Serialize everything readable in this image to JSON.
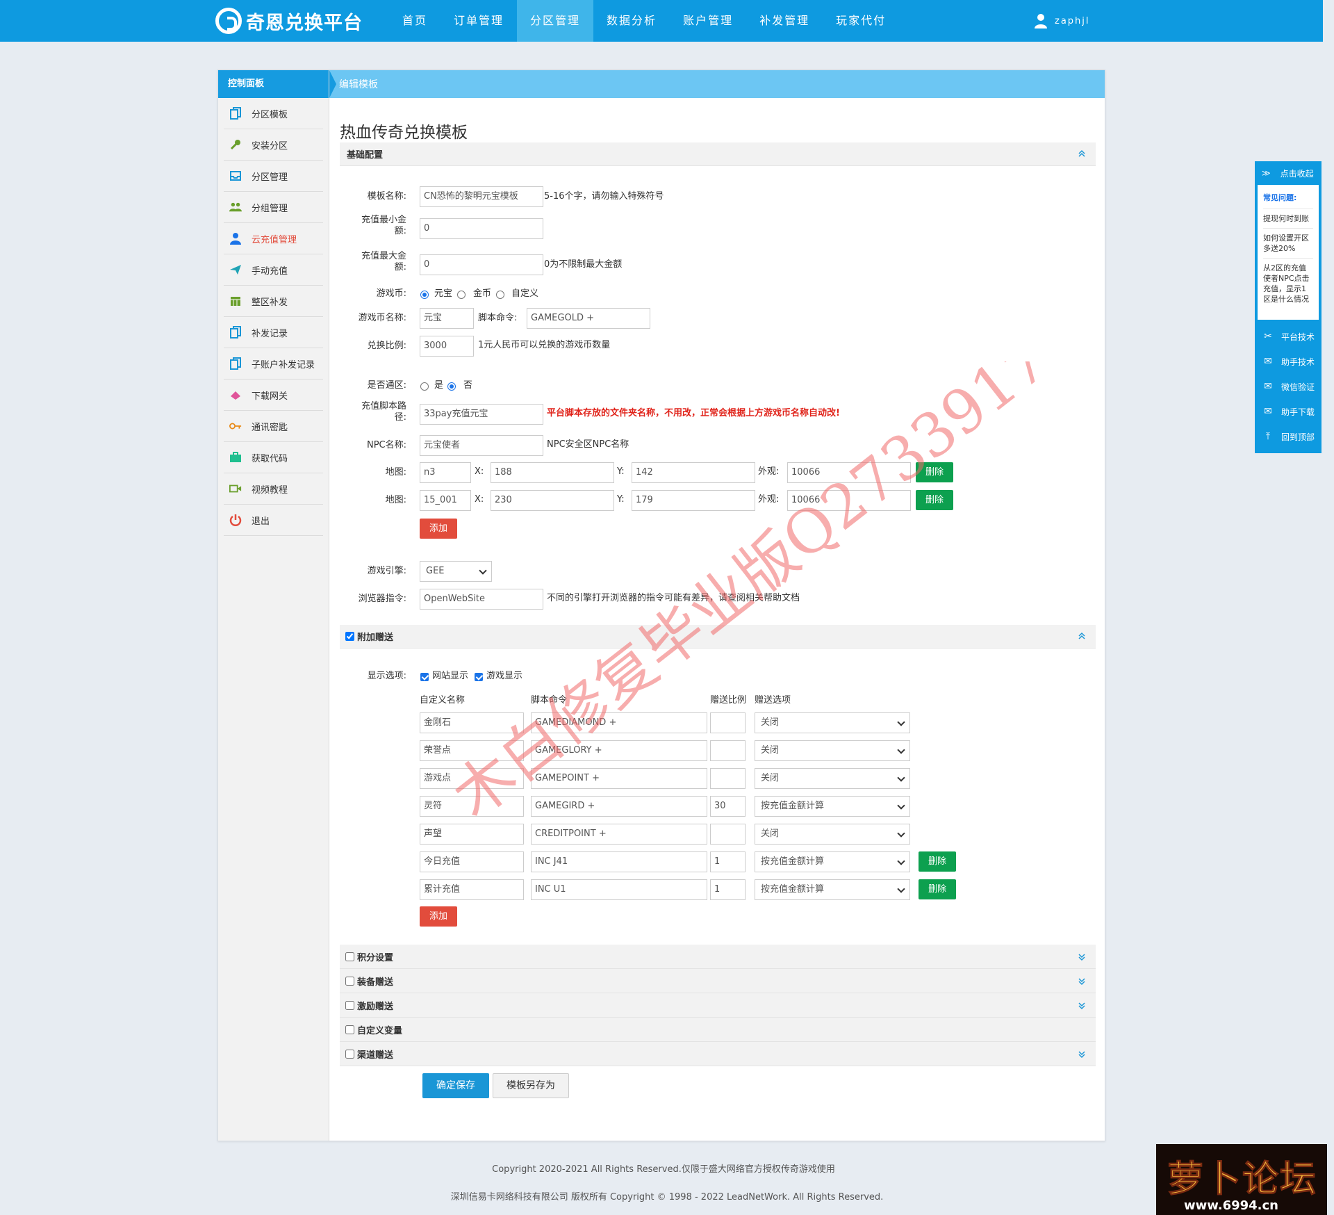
{
  "topnav": {
    "brand": "奇恩兑换平台",
    "items": [
      "首页",
      "订单管理",
      "分区管理",
      "数据分析",
      "账户管理",
      "补发管理",
      "玩家代付"
    ],
    "active_index": 2,
    "user": "zaphjl"
  },
  "sidebar": {
    "title": "控制面板",
    "items": [
      {
        "label": "分区模板",
        "icon": "copy-icon",
        "color": "#1a96d6"
      },
      {
        "label": "安装分区",
        "icon": "wrench-icon",
        "color": "#6a9f2c"
      },
      {
        "label": "分区管理",
        "icon": "inbox-icon",
        "color": "#1a96d6"
      },
      {
        "label": "分组管理",
        "icon": "group-icon",
        "color": "#6a9f2c"
      },
      {
        "label": "云充值管理",
        "icon": "user-icon",
        "color": "#1a73e8",
        "active": true
      },
      {
        "label": "手动充值",
        "icon": "paper-plane-icon",
        "color": "#1fa3b5"
      },
      {
        "label": "整区补发",
        "icon": "calendar-icon",
        "color": "#6a9f2c"
      },
      {
        "label": "补发记录",
        "icon": "copy-icon",
        "color": "#1a96d6"
      },
      {
        "label": "子账户补发记录",
        "icon": "copy-icon",
        "color": "#1a96d6"
      },
      {
        "label": "下载网关",
        "icon": "eraser-icon",
        "color": "#e0549a"
      },
      {
        "label": "通讯密匙",
        "icon": "key-icon",
        "color": "#e88b1a"
      },
      {
        "label": "获取代码",
        "icon": "briefcase-icon",
        "color": "#1fbf8f"
      },
      {
        "label": "视频教程",
        "icon": "video-icon",
        "color": "#6a9f2c"
      },
      {
        "label": "退出",
        "icon": "power-icon",
        "color": "#e24c3c"
      }
    ]
  },
  "panel": {
    "title": "编辑模板"
  },
  "page": {
    "title": "热血传奇兑换模板"
  },
  "basic": {
    "section_title": "基础配置",
    "template_name": {
      "label": "模板名称:",
      "value": "CN恐怖的黎明元宝模板",
      "hint": "5-16个字，请勿输入特殊符号"
    },
    "min_amount": {
      "label_1": "充值最小金",
      "label_2": "额:",
      "value": "0"
    },
    "max_amount": {
      "label_1": "充值最大金",
      "label_2": "额:",
      "value": "0",
      "hint": "0为不限制最大金额"
    },
    "currency": {
      "label": "游戏币:",
      "options": [
        "元宝",
        "金币",
        "自定义"
      ],
      "selected": 0
    },
    "currency_name": {
      "label": "游戏币名称:",
      "value": "元宝",
      "script_label": "脚本命令:",
      "script_value": "GAMEGOLD +"
    },
    "ratio": {
      "label": "兑换比例:",
      "value": "3000",
      "hint": "1元人民币可以兑换的游戏币数量"
    },
    "universal": {
      "label": "是否通区:",
      "options": [
        "是",
        "否"
      ],
      "selected": 1
    },
    "script_path": {
      "label_1": "充值脚本路",
      "label_2": "径:",
      "value": "33pay充值元宝",
      "hint": "平台脚本存放的文件夹名称，不用改，正常会根据上方游戏币名称自动改!"
    },
    "npc": {
      "label": "NPC名称:",
      "value": "元宝使者",
      "hint": "NPC安全区NPC名称"
    },
    "maps": [
      {
        "label": "地图:",
        "map": "n3",
        "x_label": "X:",
        "x": "188",
        "y_label": "Y:",
        "y": "142",
        "look_label": "外观:",
        "look": "10066",
        "delete": "删除"
      },
      {
        "label": "地图:",
        "map": "15_001",
        "x_label": "X:",
        "x": "230",
        "y_label": "Y:",
        "y": "179",
        "look_label": "外观:",
        "look": "10066",
        "delete": "删除"
      }
    ],
    "add_label": "添加",
    "engine": {
      "label": "游戏引擎:",
      "value": "GEE"
    },
    "browser_cmd": {
      "label": "浏览器指令:",
      "value": "OpenWebSite",
      "hint": "不同的引擎打开浏览器的指令可能有差异，请查阅相关帮助文档"
    }
  },
  "bonus": {
    "section_title": "附加赠送",
    "display_label": "显示选项:",
    "display_options": [
      "网站显示",
      "游戏显示"
    ],
    "columns": [
      "自定义名称",
      "脚本命令",
      "赠送比例",
      "赠送选项"
    ],
    "rows": [
      {
        "name": "金刚石",
        "cmd": "GAMEDIAMOND +",
        "ratio": "",
        "option": "关闭"
      },
      {
        "name": "荣誉点",
        "cmd": "GAMEGLORY +",
        "ratio": "",
        "option": "关闭"
      },
      {
        "name": "游戏点",
        "cmd": "GAMEPOINT +",
        "ratio": "",
        "option": "关闭"
      },
      {
        "name": "灵符",
        "cmd": "GAMEGIRD +",
        "ratio": "30",
        "option": "按充值金额计算"
      },
      {
        "name": "声望",
        "cmd": "CREDITPOINT +",
        "ratio": "",
        "option": "关闭"
      },
      {
        "name": "今日充值",
        "cmd": "INC J41",
        "ratio": "1",
        "option": "按充值金额计算",
        "delete": "删除"
      },
      {
        "name": "累计充值",
        "cmd": "INC U1",
        "ratio": "1",
        "option": "按充值金额计算",
        "delete": "删除"
      }
    ],
    "add_label": "添加"
  },
  "collapsed_sections": [
    {
      "title": "积分设置",
      "chevron": true
    },
    {
      "title": "装备赠送",
      "chevron": true
    },
    {
      "title": "激励赠送",
      "chevron": true
    },
    {
      "title": "自定义变量",
      "chevron": false
    },
    {
      "title": "渠道赠送",
      "chevron": true
    }
  ],
  "actions": {
    "save": "确定保存",
    "save_as": "模板另存为"
  },
  "float_panel": {
    "collapse": "点击收起",
    "faq_title": "常见问题:",
    "faq": [
      "提现何时到账",
      "如何设置开区多送20%",
      "从2区的充值使者NPC点击充值，显示1区是什么情况"
    ],
    "links": [
      {
        "label": "平台技术",
        "icon": "tools-icon"
      },
      {
        "label": "助手技术",
        "icon": "chat-icon"
      },
      {
        "label": "微信验证",
        "icon": "chat-icon"
      },
      {
        "label": "助手下载",
        "icon": "chat-icon"
      },
      {
        "label": "回到顶部",
        "icon": "arrow-up-icon"
      }
    ]
  },
  "footer": {
    "line1": "Copyright 2020-2021 All Rights Reserved.仅限于盛大网络官方授权传奇游戏使用",
    "line2": "深圳信易卡网络科技有限公司 版权所有 Copyright © 1998 - 2022 LeadNetWork. All Rights Reserved."
  },
  "watermark": "木白修复毕业版Q2733917 06",
  "badge": {
    "title": "萝卜论坛",
    "url": "www.6994.cn"
  },
  "colors": {
    "primary": "#0e9ae0",
    "accent_light": "#6cc6f3",
    "danger": "#e24c3c",
    "success": "#0da04f"
  }
}
